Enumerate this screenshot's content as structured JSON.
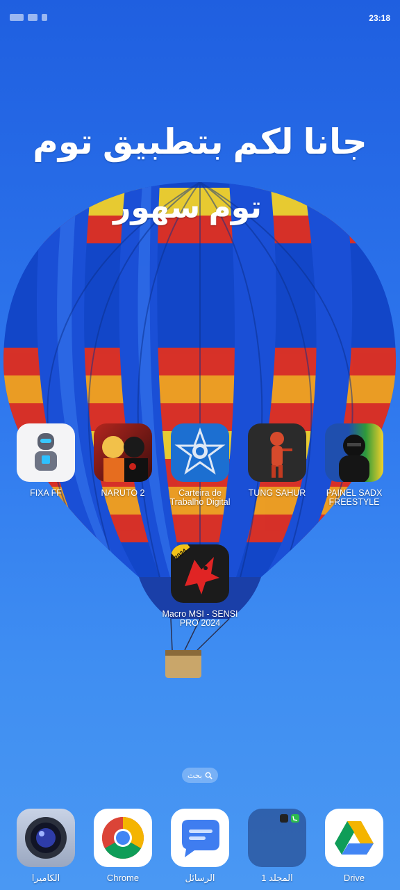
{
  "status_bar": {
    "time": "23:18"
  },
  "headline": {
    "line1": "جانا لكم بتطبيق توم",
    "line2": "توم سهور"
  },
  "apps": [
    {
      "label": "FIXA FF",
      "icon": "robot-icon"
    },
    {
      "label": "NARUTO 2",
      "icon": "anime-icon"
    },
    {
      "label": "Carteira de Trabalho Digital",
      "icon": "coat-of-arms-icon"
    },
    {
      "label": "TUNG SAHUR",
      "icon": "character-icon"
    },
    {
      "label": "PAINEL SADX FREESTYLE",
      "icon": "masked-figure-icon"
    },
    {
      "label": "Macro MSI - SENSI PRO 2024",
      "badge": "2024",
      "icon": "dragon-icon"
    }
  ],
  "search": {
    "label": "بحث"
  },
  "dock": [
    {
      "label": "الكاميرا",
      "icon": "camera-icon"
    },
    {
      "label": "Chrome",
      "icon": "chrome-icon"
    },
    {
      "label": "الرسائل",
      "icon": "messages-icon"
    },
    {
      "label": "المجلد 1",
      "icon": "folder-icon"
    },
    {
      "label": "Drive",
      "icon": "drive-icon"
    }
  ]
}
